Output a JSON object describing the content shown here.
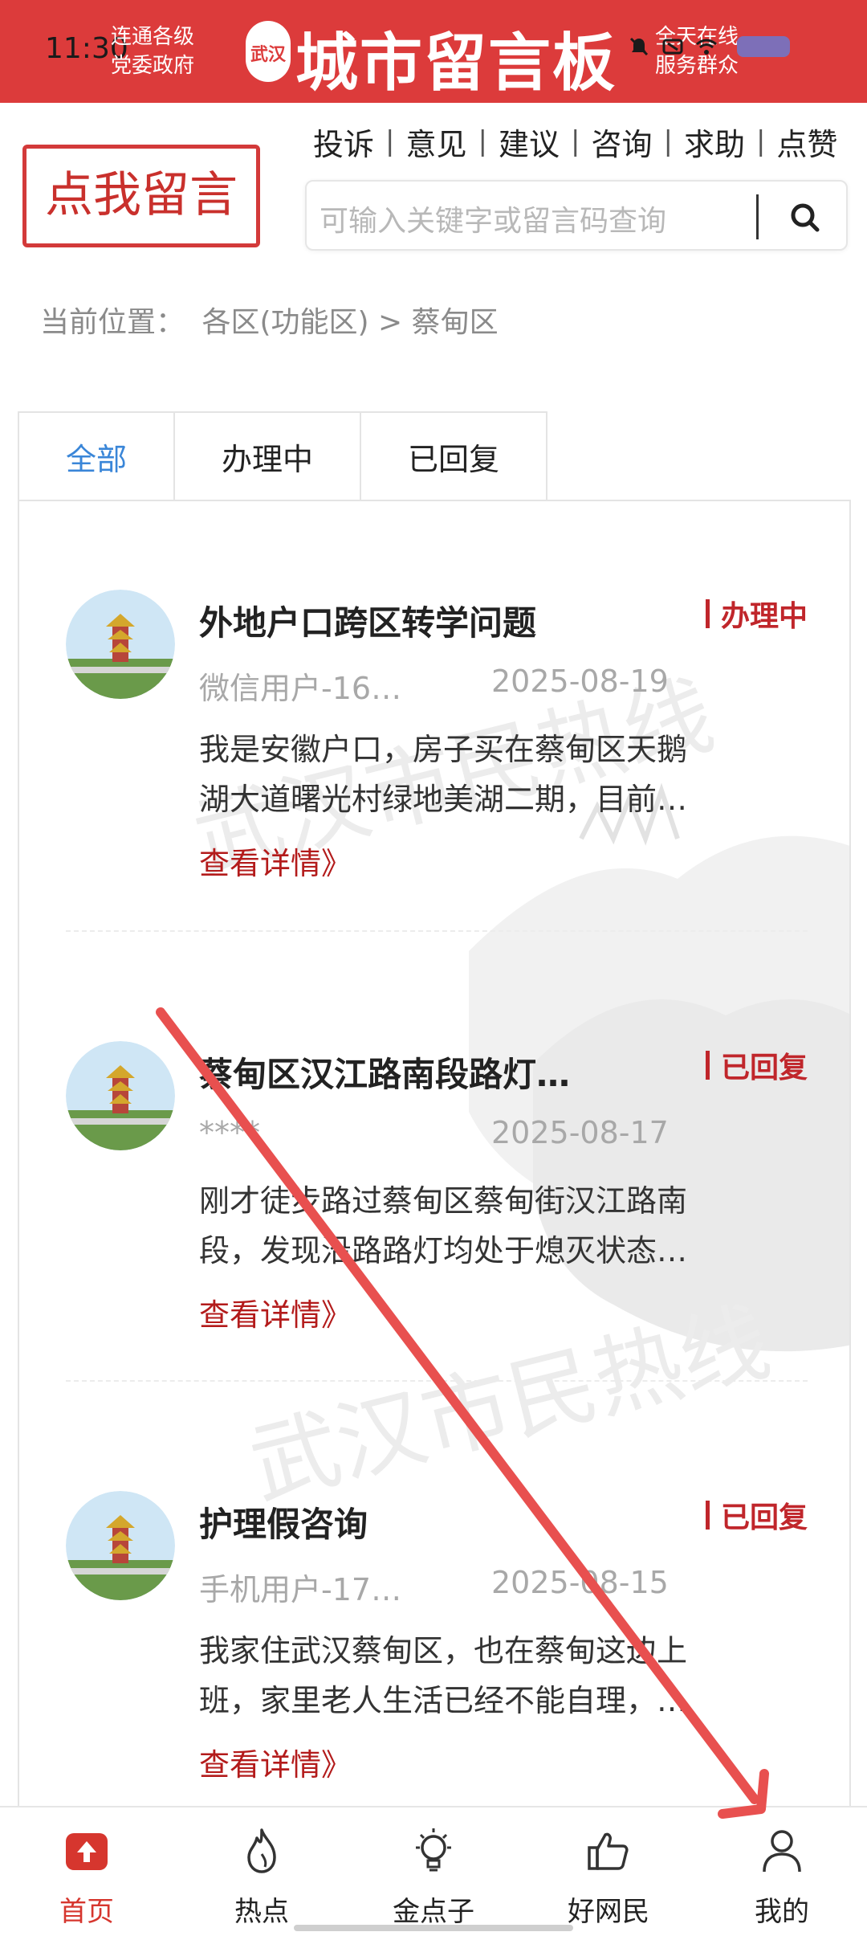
{
  "status_bar": {
    "time": "11:30"
  },
  "banner": {
    "left_line1": "连通各级",
    "left_line2": "党委政府",
    "logo_char": "武汉",
    "title": "城市留言板",
    "right_line1": "全天在线",
    "right_line2": "服务群众"
  },
  "header": {
    "leave_message_button": "点我留言",
    "categories": [
      "投诉",
      "意见",
      "建议",
      "咨询",
      "求助",
      "点赞"
    ],
    "search_placeholder": "可输入关键字或留言码查询"
  },
  "breadcrumb": {
    "label": "当前位置：",
    "path": "各区(功能区) > 蔡甸区"
  },
  "tabs": [
    {
      "label": "全部",
      "active": true
    },
    {
      "label": "办理中",
      "active": false
    },
    {
      "label": "已回复",
      "active": false
    }
  ],
  "messages": [
    {
      "title": "外地户口跨区转学问题",
      "status": "办理中",
      "user": "微信用户-16…",
      "date": "2025-08-19",
      "body_line1": "我是安徽户口，房子买在蔡甸区天鹅",
      "body_line2": "湖大道曙光村绿地美湖二期，目前…",
      "link": "查看详情》"
    },
    {
      "title": "蔡甸区汉江路南段路灯…",
      "status": "已回复",
      "user": "****",
      "date": "2025-08-17",
      "body_line1": "刚才徒步路过蔡甸区蔡甸街汉江路南",
      "body_line2": "段，发现沿路路灯均处于熄灭状态…",
      "link": "查看详情》"
    },
    {
      "title": "护理假咨询",
      "status": "已回复",
      "user": "手机用户-17…",
      "date": "2025-08-15",
      "body_line1": "我家住武汉蔡甸区，也在蔡甸这边上",
      "body_line2": "班，家里老人生活已经不能自理，…",
      "link": "查看详情》"
    }
  ],
  "bottom_nav": [
    {
      "label": "首页",
      "icon": "home-upload-icon",
      "active": true
    },
    {
      "label": "热点",
      "icon": "flame-icon",
      "active": false
    },
    {
      "label": "金点子",
      "icon": "lightbulb-icon",
      "active": false
    },
    {
      "label": "好网民",
      "icon": "thumbs-up-icon",
      "active": false
    },
    {
      "label": "我的",
      "icon": "person-icon",
      "active": false
    }
  ],
  "colors": {
    "brand_red": "#dc3b3b",
    "status_red": "#c0262b",
    "tab_active_blue": "#3a86d8",
    "annotation_arrow": "#e8504f"
  }
}
